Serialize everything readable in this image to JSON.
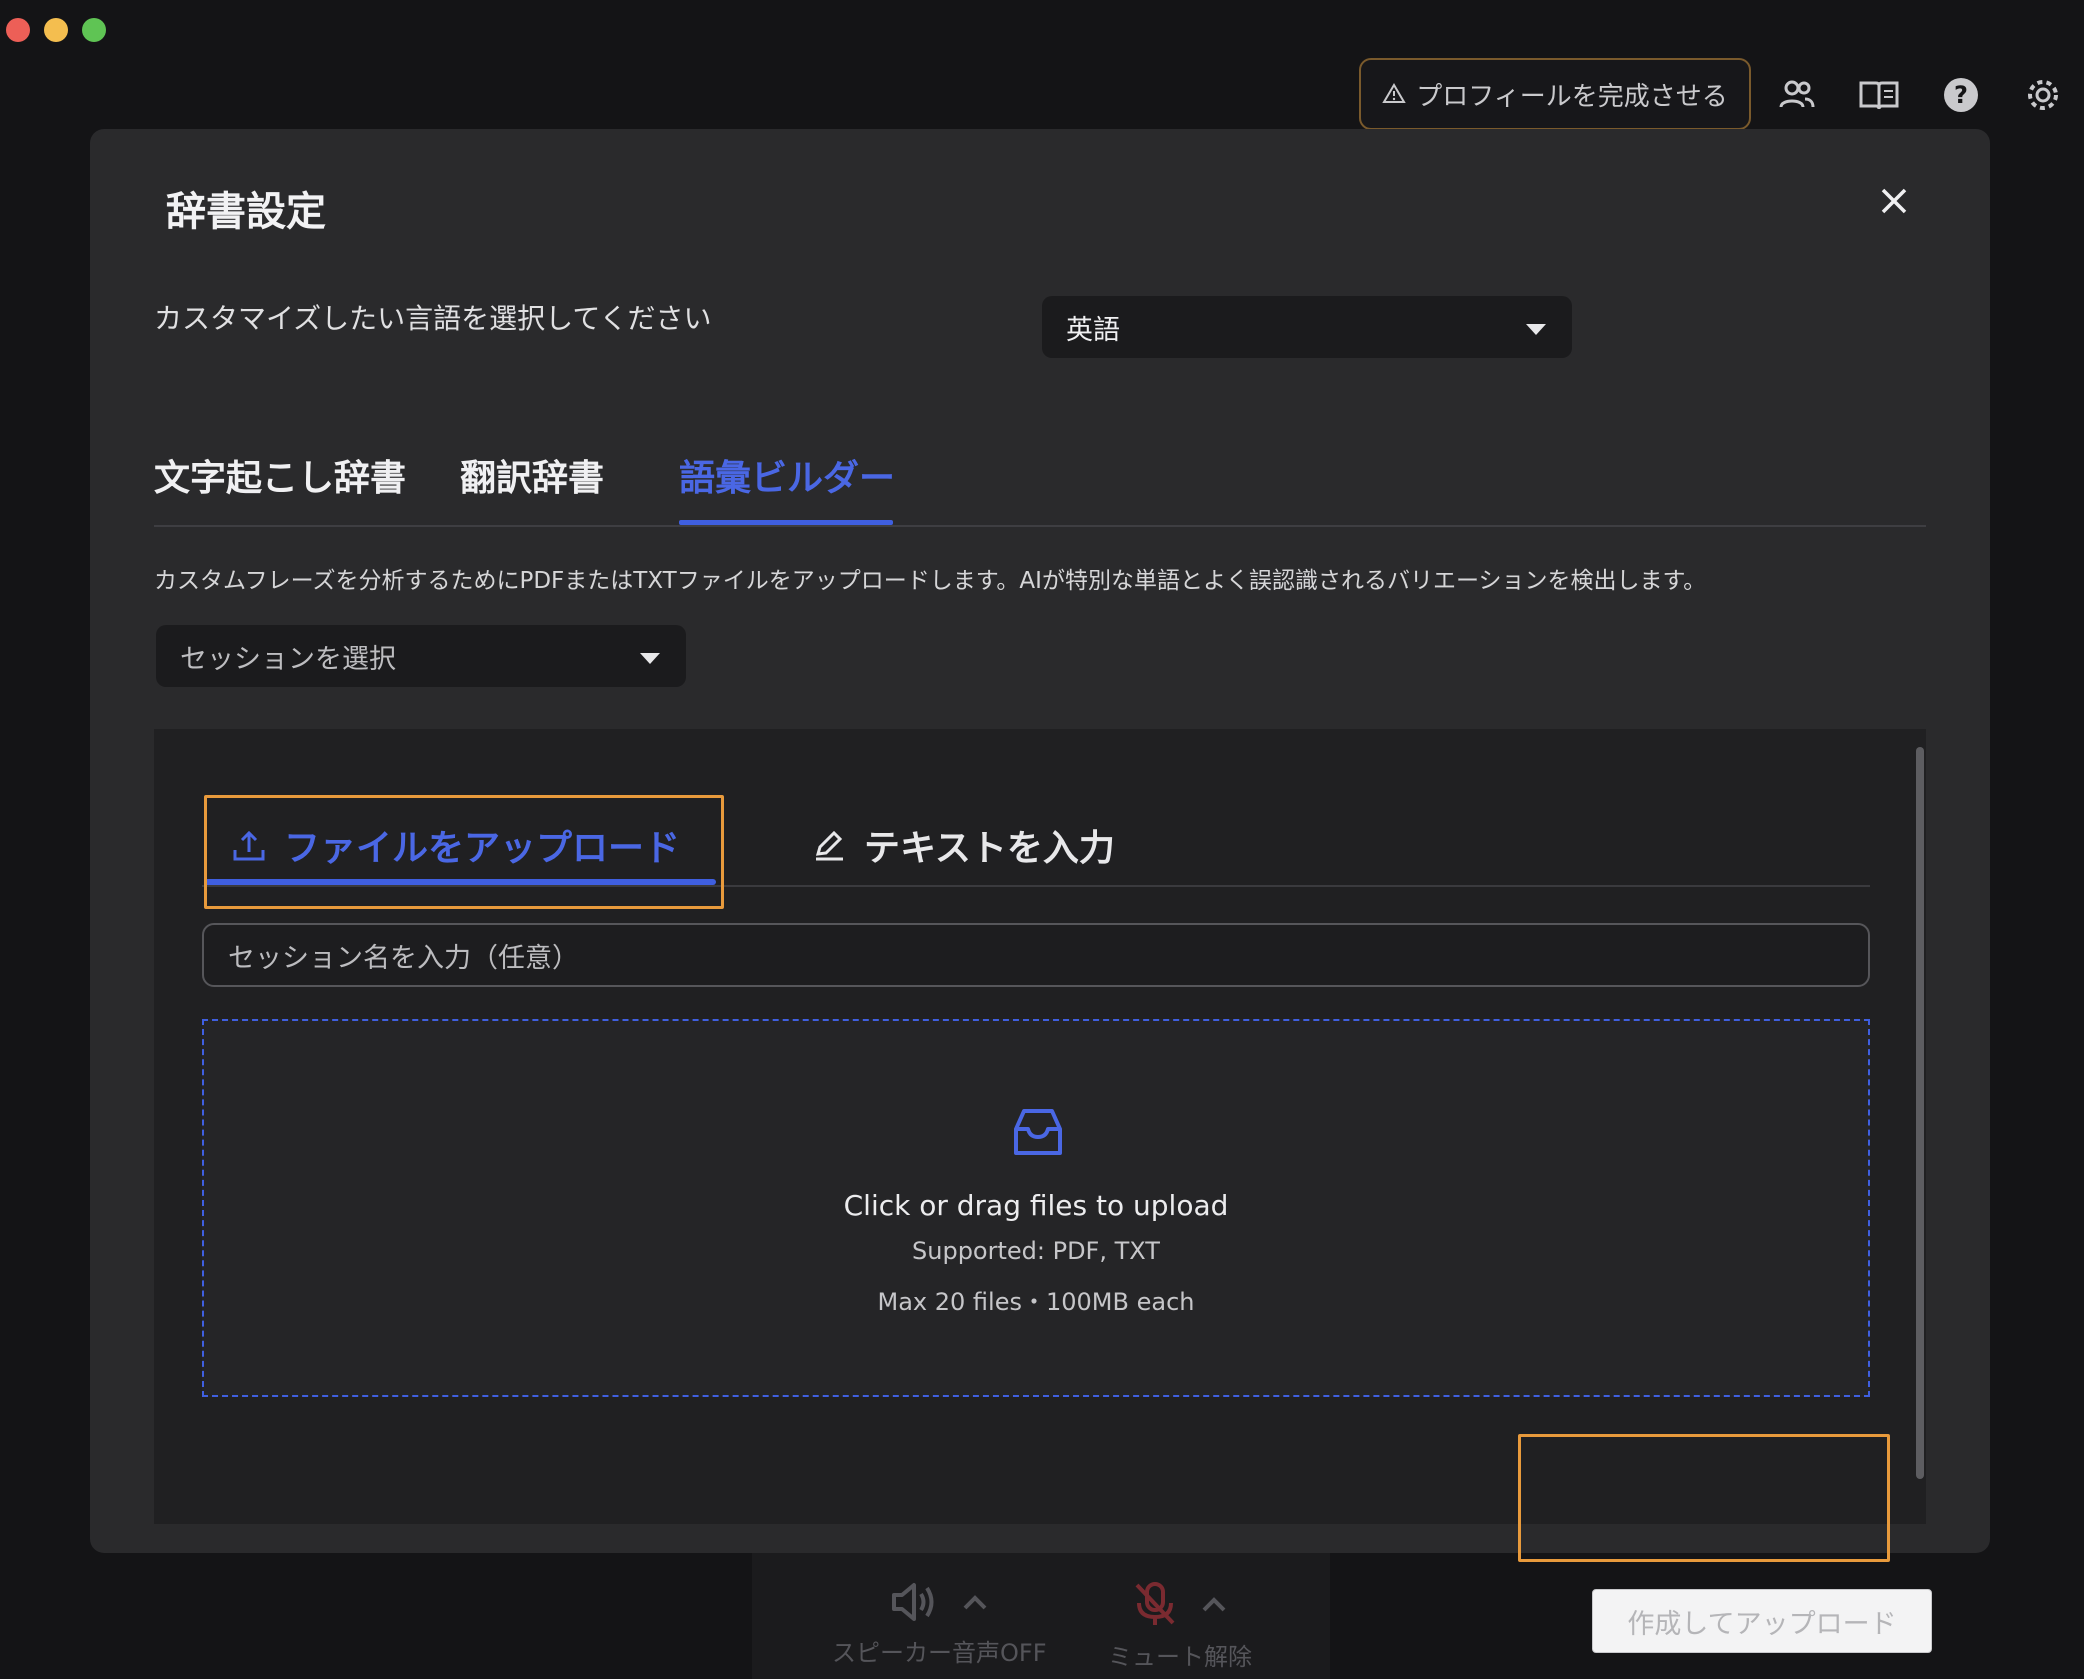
{
  "window": {
    "traffic_lights": [
      "close",
      "minimize",
      "zoom"
    ]
  },
  "topbar": {
    "profile_button": "プロフィールを完成させる",
    "icons": [
      "people-icon",
      "book-icon",
      "help-icon",
      "settings-icon"
    ]
  },
  "modal": {
    "title": "辞書設定",
    "language": {
      "label": "カスタマイズしたい言語を選択してください",
      "selected": "英語"
    },
    "tabs": [
      {
        "label": "文字起こし辞書",
        "active": false
      },
      {
        "label": "翻訳辞書",
        "active": false
      },
      {
        "label": "語彙ビルダー",
        "active": true
      }
    ],
    "description": "カスタムフレーズを分析するためにPDFまたはTXTファイルをアップロードします。AIが特別な単語とよく誤認識されるバリエーションを検出します。",
    "session_select": {
      "placeholder": "セッションを選択"
    },
    "subtabs": [
      {
        "label": "ファイルをアップロード",
        "active": true,
        "icon": "upload-icon"
      },
      {
        "label": "テキストを入力",
        "active": false,
        "icon": "pencil-icon"
      }
    ],
    "session_name": {
      "placeholder": "セッション名を入力（任意）"
    },
    "dropzone": {
      "icon": "inbox-icon",
      "title": "Click or drag files to upload",
      "supported": "Supported: PDF, TXT",
      "limits": "Max 20 files・100MB each"
    },
    "submit_button": "作成してアップロード"
  },
  "bottom_bar": {
    "speaker_label": "スピーカー音声OFF",
    "mic_label": "ミュート解除"
  },
  "colors": {
    "accent": "#3f5fe0",
    "highlight": "#e89a3c",
    "modal_bg": "#2a2a2c"
  }
}
